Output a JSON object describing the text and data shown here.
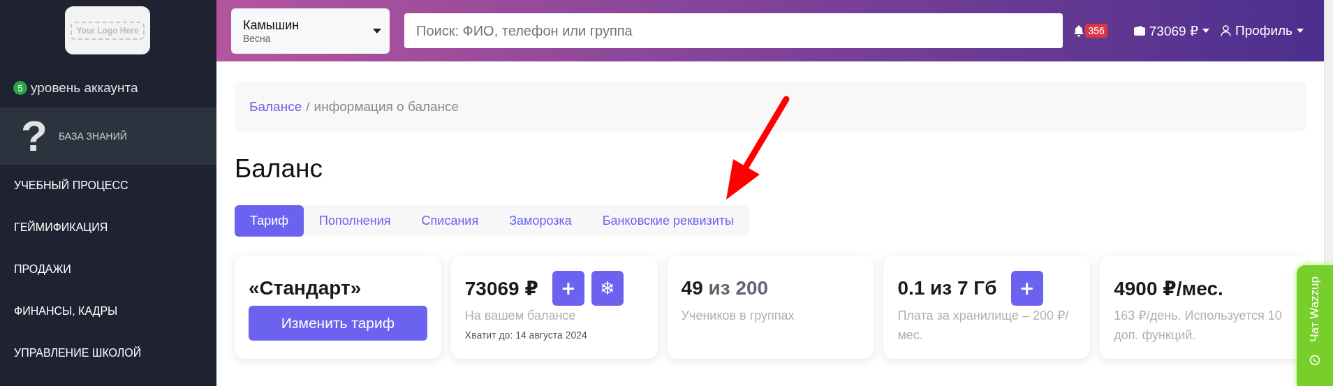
{
  "sidebar": {
    "logo_text": "Your Logo Here",
    "account_level": {
      "badge": "5",
      "label": "уровень аккаунта"
    },
    "items": [
      {
        "label": "БАЗА ЗНАНИЙ",
        "icon": "?",
        "selected": true
      },
      {
        "label": "УЧЕБНЫЙ ПРОЦЕСС",
        "selected": false
      },
      {
        "label": "ГЕЙМИФИКАЦИЯ",
        "selected": false
      },
      {
        "label": "ПРОДАЖИ",
        "selected": false
      },
      {
        "label": "ФИНАНСЫ, КАДРЫ",
        "selected": false
      },
      {
        "label": "УПРАВЛЕНИЕ ШКОЛОЙ",
        "selected": false
      }
    ]
  },
  "topbar": {
    "location": {
      "name": "Камышин",
      "season": "Весна"
    },
    "search": {
      "placeholder": "Поиск: ФИО, телефон или группа"
    },
    "notifications": {
      "count": "356"
    },
    "balance": "73069 ₽",
    "profile": "Профиль"
  },
  "breadcrumb": {
    "link": "Балансе",
    "separator": "/",
    "current": "информация о балансе"
  },
  "title": "Баланс",
  "tabs": [
    {
      "label": "Тариф",
      "selected": true
    },
    {
      "label": "Пополнения",
      "selected": false
    },
    {
      "label": "Списания",
      "selected": false
    },
    {
      "label": "Заморозка",
      "selected": false
    },
    {
      "label": "Банковские реквизиты",
      "selected": false
    }
  ],
  "cards": [
    {
      "value": "«Стандарт»",
      "action": "Изменить тариф"
    },
    {
      "value": "73069 ₽",
      "buttons": [
        "+",
        "❄"
      ],
      "caption": "На вашем балансе",
      "note": "Хватит до: 14 августа 2024"
    },
    {
      "value": "49",
      "value_muted": "из 200",
      "caption": "Учеников в группах"
    },
    {
      "value": "0.1 из 7 Гб",
      "buttons": [
        "+"
      ],
      "caption": "Плата за хранилище – 200 ₽/мес."
    },
    {
      "value": "4900 ₽/мес.",
      "caption": "163 ₽/день. Используется 10 доп. функций."
    }
  ],
  "chat_widget": {
    "label": "Чат Wazzup"
  }
}
